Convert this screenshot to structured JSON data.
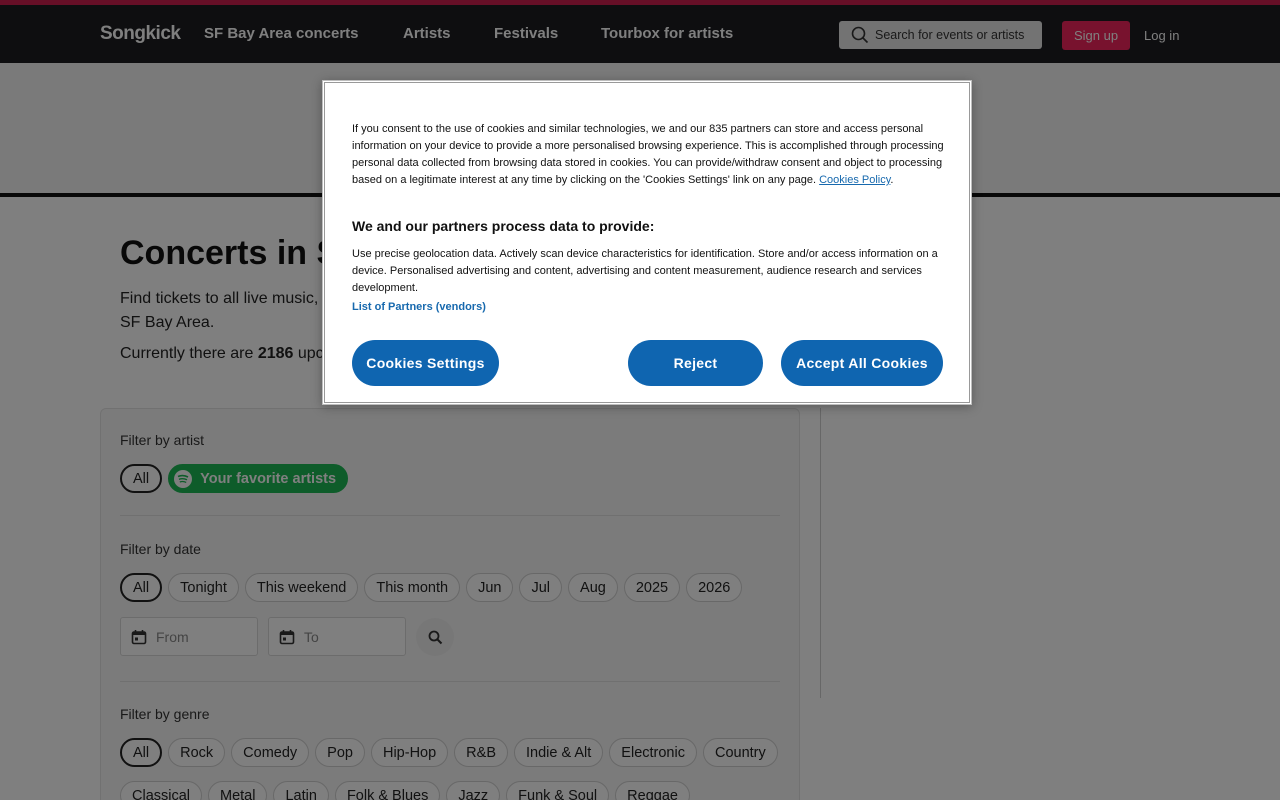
{
  "header": {
    "logo": "Songkick",
    "nav": [
      "SF Bay Area concerts",
      "Artists",
      "Festivals",
      "Tourbox for artists"
    ],
    "search_placeholder": "Search for events or artists",
    "signup": "Sign up",
    "login": "Log in"
  },
  "main": {
    "title": "Concerts in S",
    "intro": "Find tickets to all live music, concerts, tour dates and festivals in and around SF Bay Area.",
    "count_prefix": "Currently there are ",
    "count": "2186",
    "count_suffix": " upcoming events."
  },
  "filters": {
    "artist": {
      "label": "Filter by artist",
      "all": "All",
      "favorite": "Your favorite artists"
    },
    "date": {
      "label": "Filter by date",
      "chips": [
        "All",
        "Tonight",
        "This weekend",
        "This month",
        "Jun",
        "Jul",
        "Aug",
        "2025",
        "2026"
      ],
      "from_placeholder": "From",
      "to_placeholder": "To"
    },
    "genre": {
      "label": "Filter by genre",
      "row1": [
        "All",
        "Rock",
        "Comedy",
        "Pop",
        "Hip-Hop",
        "R&B",
        "Indie & Alt",
        "Electronic",
        "Country"
      ],
      "row2": [
        "Classical",
        "Metal",
        "Latin",
        "Folk & Blues",
        "Jazz",
        "Funk & Soul",
        "Reggae"
      ]
    }
  },
  "consent": {
    "text": "If you consent to the use of cookies and similar technologies, we and our 835 partners can store and access personal information on your device to provide a more personalised browsing experience. This is accomplished through processing personal data collected from browsing data stored in cookies. You can provide/withdraw consent and object to processing based on a legitimate interest at any time by clicking on the 'Cookies Settings' link on any page.",
    "policy_link": "Cookies Policy",
    "heading": "We and our partners process data to provide:",
    "purposes": "Use precise geolocation data. Actively scan device characteristics for identification. Store and/or access information on a device. Personalised advertising and content, advertising and content measurement, audience research and services development.",
    "partners_link": "List of Partners (vendors)",
    "settings_btn": "Cookies Settings",
    "reject_btn": "Reject",
    "accept_btn": "Accept All Cookies"
  },
  "colors": {
    "brand": "#f0245c",
    "nav_bg": "#1c1d21",
    "consent_button": "#0f65b0",
    "spotify_green": "#1db954"
  }
}
